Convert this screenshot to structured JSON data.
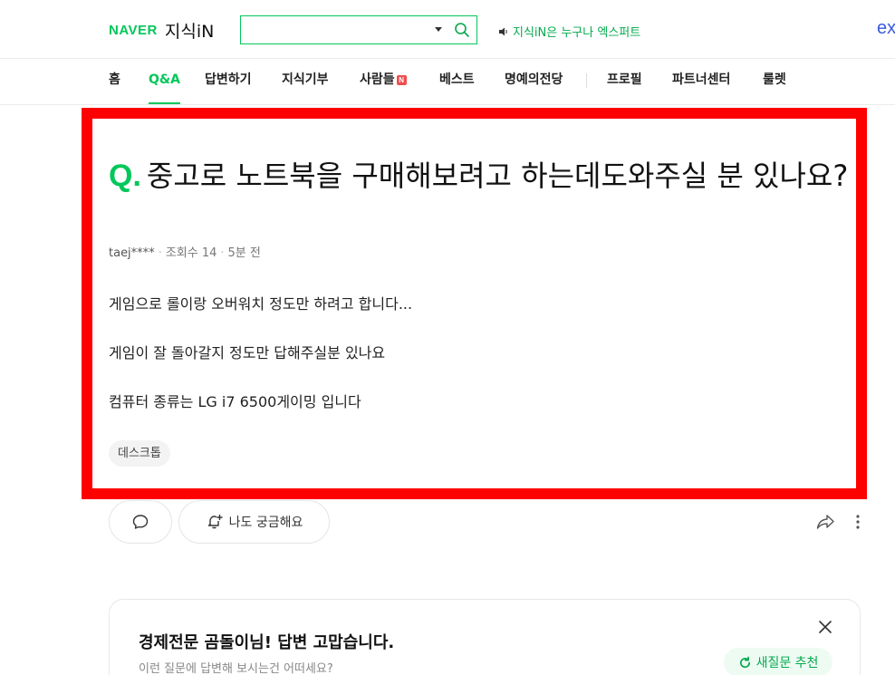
{
  "header": {
    "logo_naver": "NAVER",
    "logo_kin": "지식iN",
    "search": {
      "value": "",
      "placeholder": ""
    },
    "notice": "지식iN은 누구나 엑스퍼트",
    "right_logo": "ex"
  },
  "nav": {
    "items": [
      {
        "label": "홈",
        "active": false
      },
      {
        "label": "Q&A",
        "active": true
      },
      {
        "label": "답변하기",
        "active": false
      },
      {
        "label": "지식기부",
        "active": false
      },
      {
        "label": "사람들",
        "active": false,
        "badge": "N"
      },
      {
        "label": "베스트",
        "active": false
      },
      {
        "label": "명예의전당",
        "active": false
      },
      {
        "label": "프로필",
        "active": false
      },
      {
        "label": "파트너센터",
        "active": false
      },
      {
        "label": "룰렛",
        "active": false
      }
    ]
  },
  "question": {
    "q_mark": "Q.",
    "title": "중고로 노트북을 구매해보려고 하는데도와주실 분 있나요?",
    "author": "taej****",
    "views": "조회수 14",
    "time": "5분 전",
    "body": [
      "게임으로 롤이랑 오버워치 정도만 하려고 합니다...",
      "게임이 잘 돌아갈지 정도만 답해주실분 있나요",
      "컴퓨터 종류는 LG i7 6500게이밍 입니다"
    ],
    "tag": "데스크톱"
  },
  "actions": {
    "curious_label": "나도 궁금해요"
  },
  "card": {
    "title": "경제전문 곰돌이님! 답변 고맙습니다.",
    "subtitle": "이런 질문에 답변해 보시는건 어떠세요?",
    "button_label": "새질문 추천"
  },
  "colors": {
    "brand_green": "#03c75a",
    "highlight_red": "#ff0000"
  }
}
